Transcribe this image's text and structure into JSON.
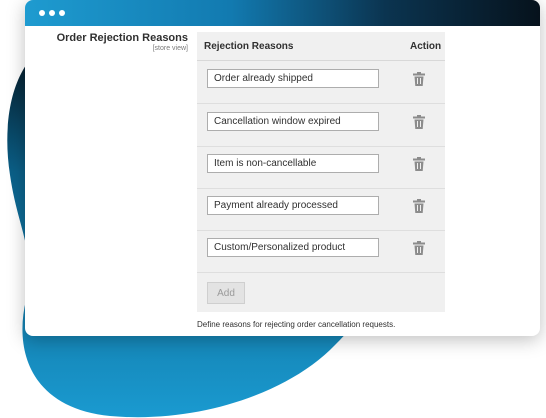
{
  "window": {
    "titlebar_gradient": [
      "#1e9bd0",
      "#06121c"
    ]
  },
  "field": {
    "label": "Order Rejection Reasons",
    "scope": "[store view]"
  },
  "grid": {
    "columns": {
      "reasons": "Rejection Reasons",
      "action": "Action"
    },
    "rows": [
      {
        "value": "Order already shipped",
        "action_icon": "trash-icon"
      },
      {
        "value": "Cancellation window expired",
        "action_icon": "trash-icon"
      },
      {
        "value": "Item is non-cancellable",
        "action_icon": "trash-icon"
      },
      {
        "value": "Payment already processed",
        "action_icon": "trash-icon"
      },
      {
        "value": "Custom/Personalized product",
        "action_icon": "trash-icon"
      }
    ],
    "add_label": "Add"
  },
  "note": "Define reasons for rejecting order cancellation requests.",
  "colors": {
    "accent_blue": "#1e9bd0",
    "dark": "#06121c",
    "grid_bg": "#f0f0f0"
  }
}
